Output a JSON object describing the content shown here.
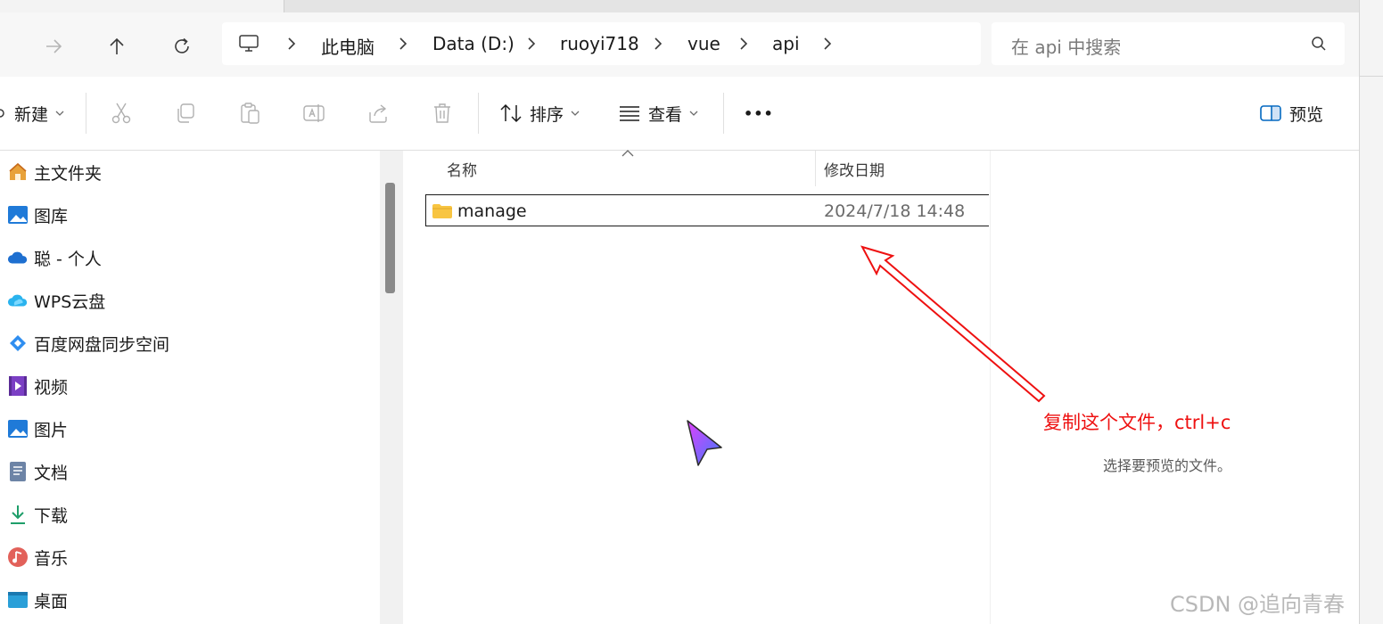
{
  "nav": {
    "breadcrumbs": [
      "此电脑",
      "Data (D:)",
      "ruoyi718",
      "vue",
      "api"
    ],
    "search_placeholder": "在 api 中搜索"
  },
  "toolbar": {
    "new_label": "新建",
    "sort_label": "排序",
    "view_label": "查看",
    "more_label": "•••",
    "preview_label": "预览"
  },
  "sidebar": {
    "items": [
      {
        "label": "主文件夹",
        "icon": "home-icon"
      },
      {
        "label": "图库",
        "icon": "gallery-icon"
      },
      {
        "label": "聪 - 个人",
        "icon": "onedrive-cloud-icon"
      },
      {
        "label": "WPS云盘",
        "icon": "wps-cloud-icon"
      },
      {
        "label": "百度网盘同步空间",
        "icon": "baidu-netdisk-icon"
      },
      {
        "label": "视频",
        "icon": "videos-icon"
      },
      {
        "label": "图片",
        "icon": "pictures-icon"
      },
      {
        "label": "文档",
        "icon": "documents-icon"
      },
      {
        "label": "下载",
        "icon": "download-icon"
      },
      {
        "label": "音乐",
        "icon": "music-icon"
      },
      {
        "label": "桌面",
        "icon": "desktop-icon"
      }
    ]
  },
  "file_list": {
    "columns": [
      "名称",
      "修改日期"
    ],
    "rows": [
      {
        "name": "manage",
        "modified": "2024/7/18 14:48",
        "icon": "folder-icon"
      }
    ]
  },
  "preview_pane": {
    "empty_text": "选择要预览的文件。"
  },
  "annotation": {
    "text": "复制这个文件，ctrl+c",
    "color": "#ee1111"
  },
  "watermark": "CSDN @追向青春",
  "colors": {
    "accent": "#0067c0",
    "folder": "#f8c542",
    "annotation": "#ee1111"
  }
}
